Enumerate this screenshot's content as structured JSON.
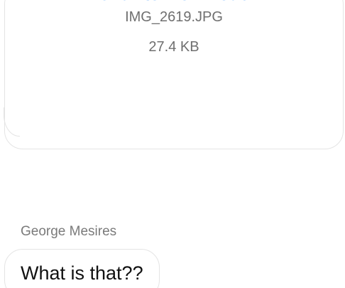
{
  "attachment": {
    "download_label": "Click to Download",
    "file_name": "IMG_2619.JPG",
    "file_size": "27.4 KB"
  },
  "message": {
    "sender": "George Mesires",
    "text": "What is that??"
  },
  "colors": {
    "link": "#1a80f2",
    "meta_text": "#6f6f6f",
    "bubble_border": "#e4e4e4",
    "message_text": "#111111"
  }
}
